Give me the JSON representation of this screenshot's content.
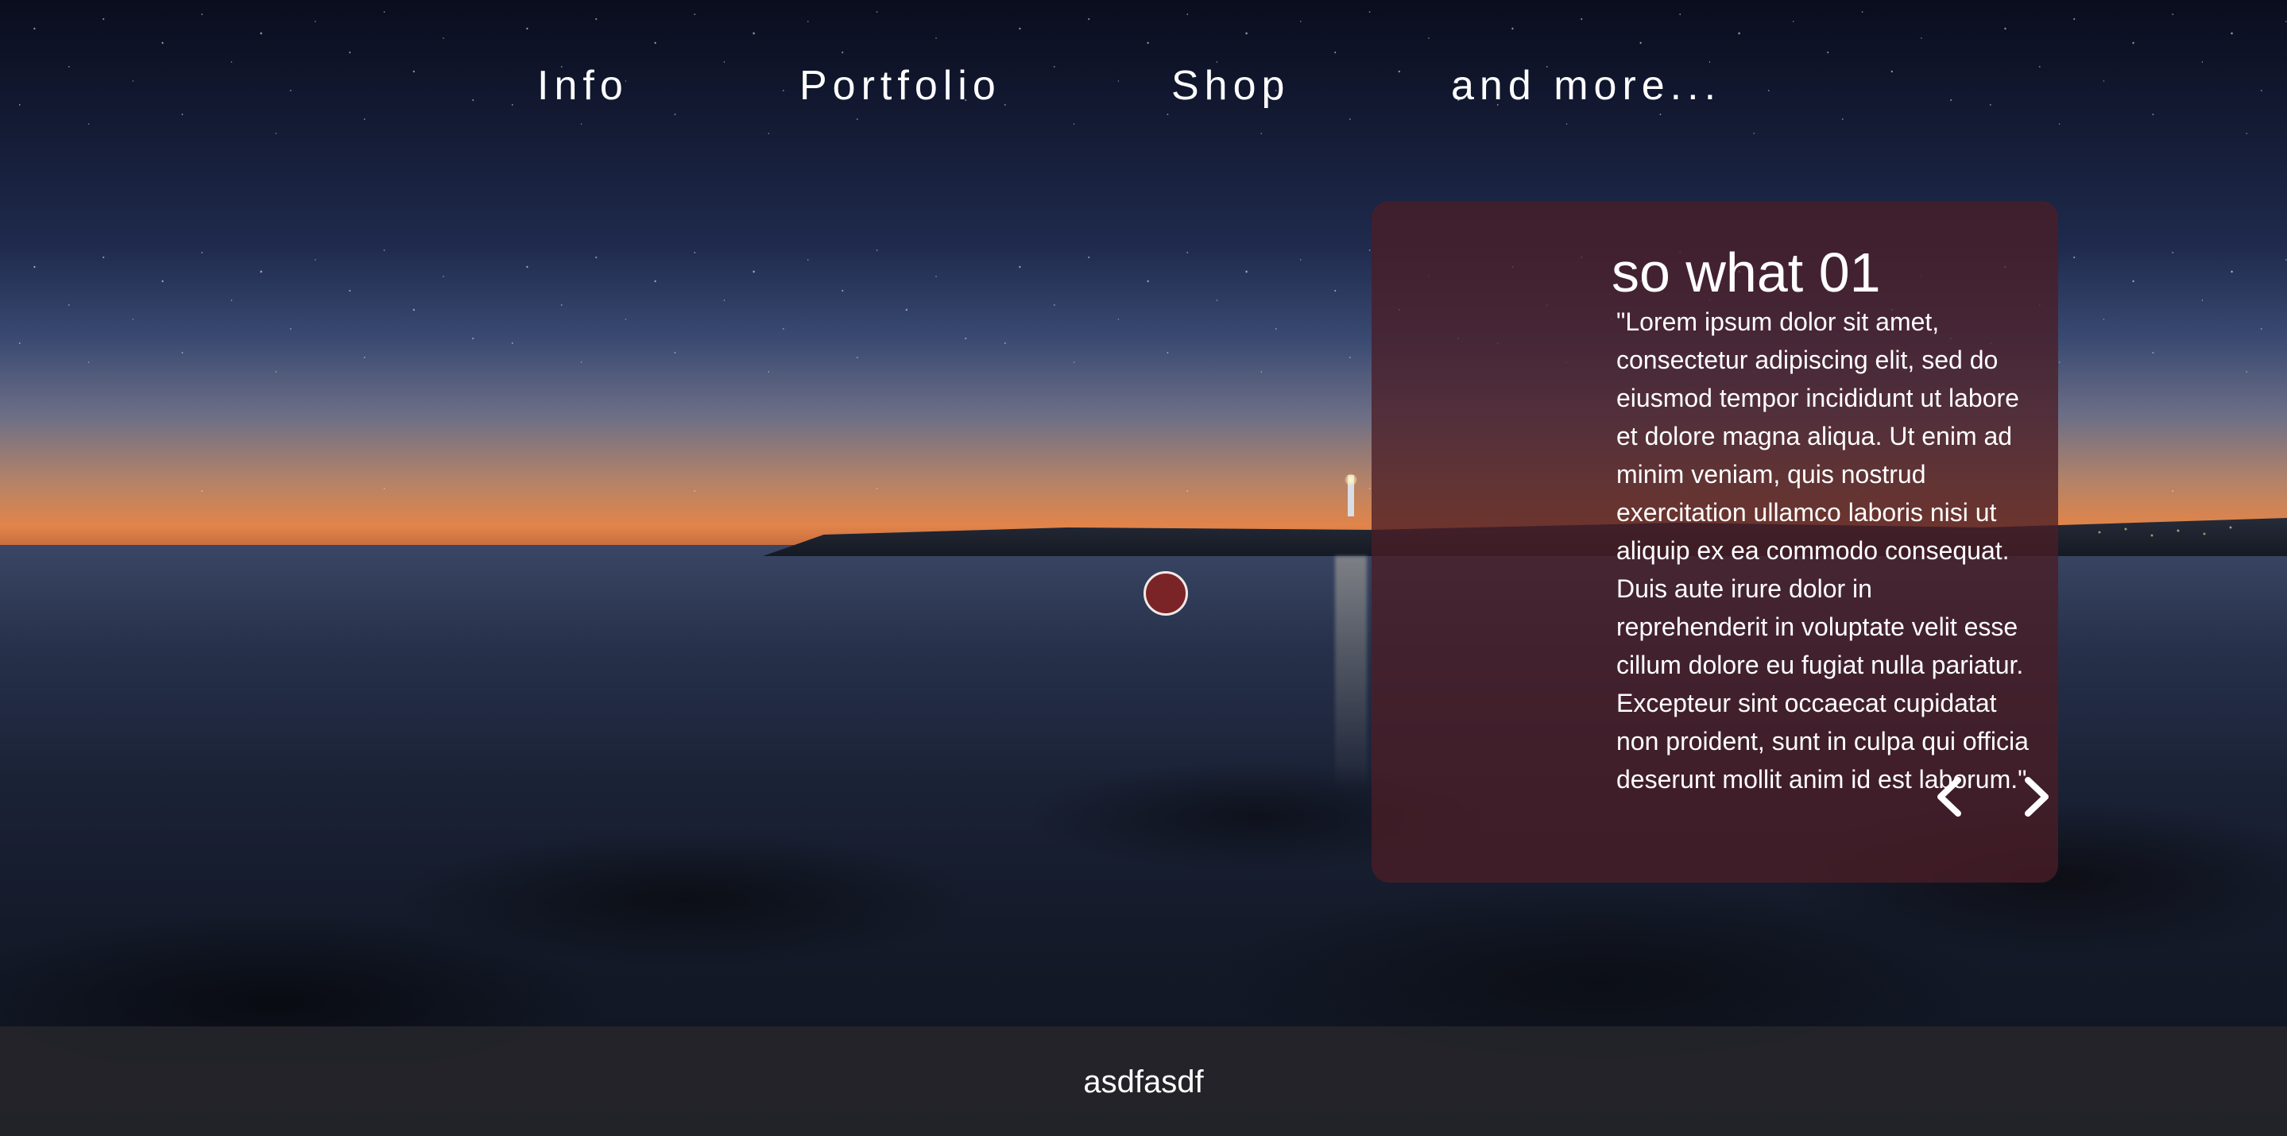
{
  "nav": {
    "items": [
      {
        "label": "Info"
      },
      {
        "label": "Portfolio"
      },
      {
        "label": "Shop"
      },
      {
        "label": "and more..."
      }
    ]
  },
  "card": {
    "title": "so what 01",
    "body": "\"Lorem ipsum dolor sit amet, consectetur adipiscing elit, sed do eiusmod tempor incididunt ut labore et dolore magna aliqua. Ut enim ad minim veniam, quis nostrud exercitation ullamco laboris nisi ut aliquip ex ea commodo consequat. Duis aute irure dolor in reprehenderit in voluptate velit esse cillum dolore eu fugiat nulla pariatur. Excepteur sint occaecat cupidatat non proident, sunt in culpa qui officia deserunt mollit anim id est laborum.\"",
    "prev_icon": "chevron-left-icon",
    "next_icon": "chevron-right-icon"
  },
  "footer": {
    "text": "asdfasdf"
  },
  "colors": {
    "card_background": "#4a1e26",
    "dot_fill": "#7b2428",
    "footer_background": "#26262a",
    "text": "#ffffff"
  }
}
